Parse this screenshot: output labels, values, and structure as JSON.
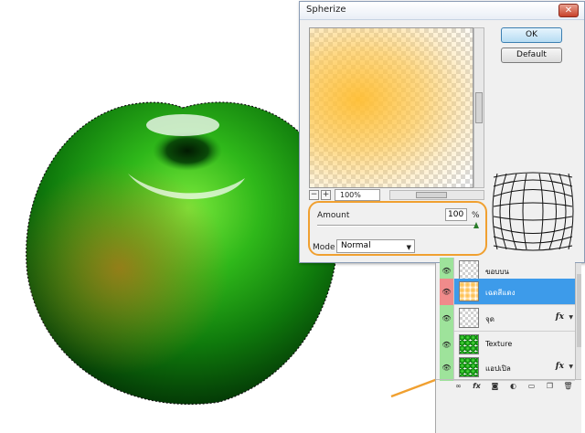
{
  "dialog": {
    "title": "Spherize",
    "close_glyph": "✕",
    "ok_label": "OK",
    "default_label": "Default",
    "zoom_minus": "−",
    "zoom_plus": "+",
    "zoom_value": "100%",
    "amount_label": "Amount",
    "amount_value": "100",
    "amount_unit": "%",
    "amount_fraction": 1.0,
    "mode_label": "Mode",
    "mode_value": "Normal"
  },
  "layers_panel": {
    "layers": [
      {
        "name": "ขอบบน",
        "thumb": "transparent",
        "active": false,
        "fx": false
      },
      {
        "name": "เฉดสีแดง",
        "thumb": "orange",
        "active": true,
        "fx": false
      },
      {
        "name": "จุด",
        "thumb": "transparent",
        "active": false,
        "fx": true
      },
      {
        "name": "Texture",
        "thumb": "apple",
        "active": false,
        "fx": false
      },
      {
        "name": "แอปเปิล",
        "thumb": "apple",
        "active": false,
        "fx": true
      }
    ],
    "fx_label": "fx",
    "toolbar_icons": [
      "link-icon",
      "fx-icon",
      "mask-icon",
      "adjustment-icon",
      "folder-icon",
      "new-layer-icon",
      "trash-icon"
    ]
  },
  "colors": {
    "apple_green": "#1fa818",
    "highlight_orange": "#f0a030",
    "active_layer_blue": "#3d9bea"
  }
}
